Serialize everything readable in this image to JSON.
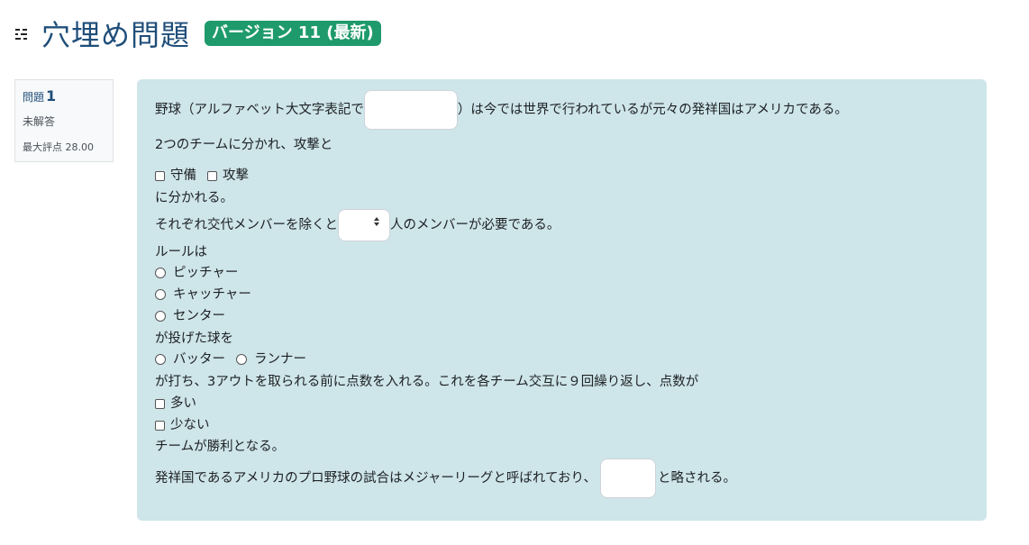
{
  "header": {
    "title": "穴埋め問題",
    "version_badge": "バージョン 11 (最新)",
    "accent_color": "#1f9a6c",
    "title_color": "#1f4e79",
    "icon": "question-type-icon"
  },
  "info": {
    "question_label": "問題",
    "question_number": "1",
    "state": "未解答",
    "max_grade": "最大評点 28.00"
  },
  "question": {
    "line1_before": "野球（アルファベット大文字表記で",
    "line1_after": "）は今では世界で行われているが元々の発祥国はアメリカである。",
    "line2": "2つのチームに分かれ、攻撃と",
    "checkbox_group1": [
      "守備",
      "攻撃"
    ],
    "line3": "に分かれる。",
    "line4_before": "それぞれ交代メンバーを除くと",
    "line4_after": "人のメンバーが必要である。",
    "line5": "ルールは",
    "radio_group1": [
      "ピッチャー",
      "キャッチャー",
      "センター"
    ],
    "line6": "が投げた球を",
    "radio_group2": [
      "バッター",
      "ランナー"
    ],
    "line7": "が打ち、3アウトを取られる前に点数を入れる。これを各チーム交互に９回繰り返し、点数が",
    "checkbox_group2": [
      "多い",
      "少ない"
    ],
    "line8": "チームが勝利となる。",
    "line9_before": "発祥国であるアメリカのプロ野球の試合はメジャーリーグと呼ばれており、",
    "line9_after": "と略される。"
  }
}
